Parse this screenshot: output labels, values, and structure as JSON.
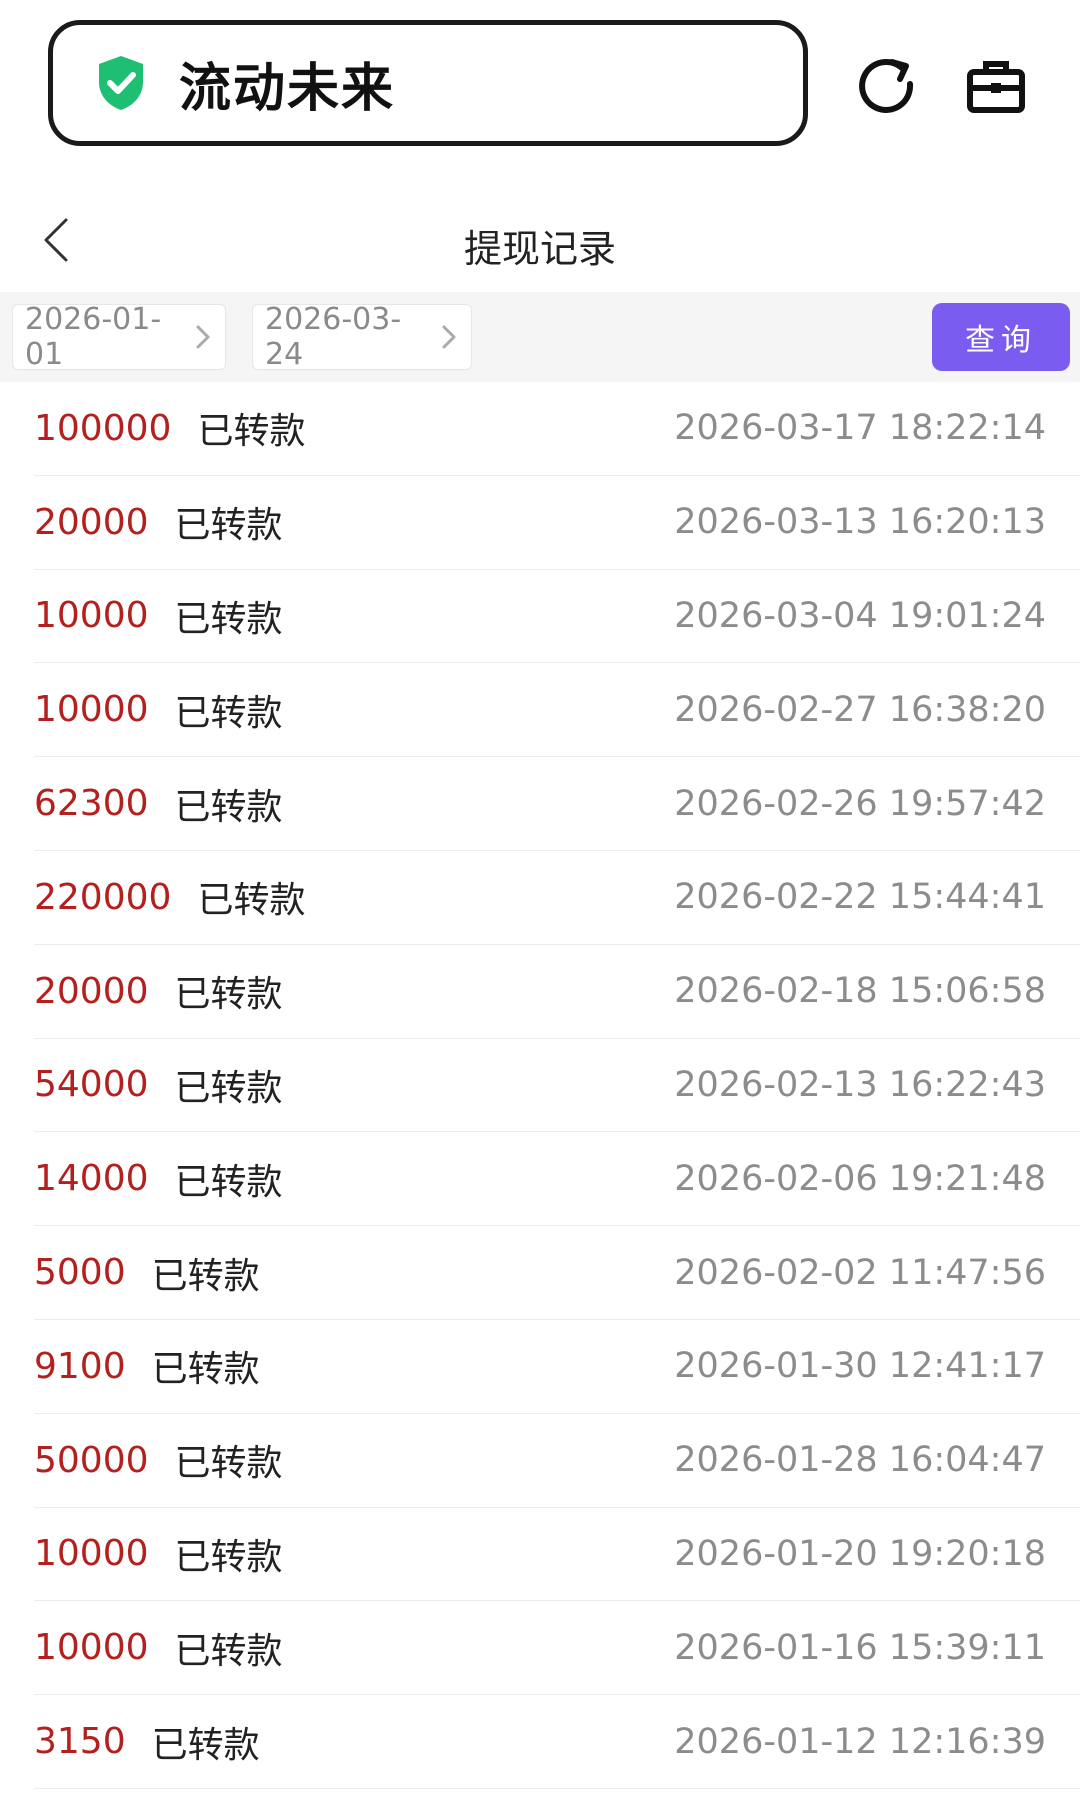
{
  "topbar": {
    "site_name": "流动未来",
    "shield_color": "#1fbf73"
  },
  "navbar": {
    "title": "提现记录"
  },
  "filter": {
    "start_date": "2026-01-01",
    "end_date": "2026-03-24",
    "query_label": "查询",
    "accent": "#7b5cf0"
  },
  "records": [
    {
      "amount": "100000",
      "status": "已转款",
      "time": "2026-03-17 18:22:14"
    },
    {
      "amount": "20000",
      "status": "已转款",
      "time": "2026-03-13 16:20:13"
    },
    {
      "amount": "10000",
      "status": "已转款",
      "time": "2026-03-04 19:01:24"
    },
    {
      "amount": "10000",
      "status": "已转款",
      "time": "2026-02-27 16:38:20"
    },
    {
      "amount": "62300",
      "status": "已转款",
      "time": "2026-02-26 19:57:42"
    },
    {
      "amount": "220000",
      "status": "已转款",
      "time": "2026-02-22 15:44:41"
    },
    {
      "amount": "20000",
      "status": "已转款",
      "time": "2026-02-18 15:06:58"
    },
    {
      "amount": "54000",
      "status": "已转款",
      "time": "2026-02-13 16:22:43"
    },
    {
      "amount": "14000",
      "status": "已转款",
      "time": "2026-02-06 19:21:48"
    },
    {
      "amount": "5000",
      "status": "已转款",
      "time": "2026-02-02 11:47:56"
    },
    {
      "amount": "9100",
      "status": "已转款",
      "time": "2026-01-30 12:41:17"
    },
    {
      "amount": "50000",
      "status": "已转款",
      "time": "2026-01-28 16:04:47"
    },
    {
      "amount": "10000",
      "status": "已转款",
      "time": "2026-01-20 19:20:18"
    },
    {
      "amount": "10000",
      "status": "已转款",
      "time": "2026-01-16 15:39:11"
    },
    {
      "amount": "3150",
      "status": "已转款",
      "time": "2026-01-12 12:16:39"
    }
  ]
}
